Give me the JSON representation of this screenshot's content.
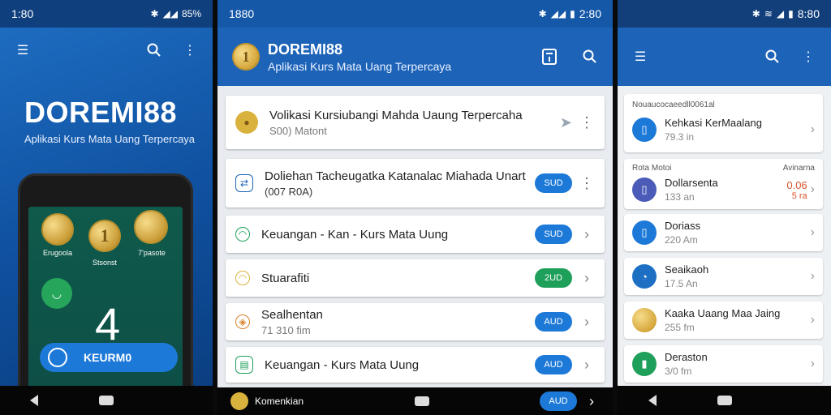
{
  "panel1": {
    "status_time": "1:80",
    "status_battery": "85%",
    "title": "DOREMI88",
    "subtitle": "Aplikasi Kurs Mata Uang Terpercaya",
    "phone": {
      "coins": [
        {
          "glyph": "",
          "label": "Erugoola"
        },
        {
          "glyph": "1",
          "label": "Stsonst"
        },
        {
          "glyph": "",
          "label": "7'pasote"
        }
      ],
      "big_number": "4",
      "button_label": "KEURM0"
    }
  },
  "panel2": {
    "status_time": "1880",
    "status_clock": "2:80",
    "title": "DOREMI88",
    "subtitle": "Aplikasi Kurs Mata Uang Terpercaya",
    "logo_glyph": "1",
    "cards": [
      {
        "main": "Volikasi Kursiubangi Mahda Uaung Terpercaha",
        "sub": "S00) Matont",
        "lead_color": "#d9b23d"
      },
      {
        "main": "Doliehan Tacheugatka Katanalac Miahada Unart",
        "sub": "(007 R0A)",
        "badge": "SUD",
        "badge_color": "#1d79d8"
      },
      {
        "main": "Keuangan - Kan - Kurs Mata Uung",
        "badge": "SUD",
        "badge_color": "#1d79d8"
      },
      {
        "main": "Stuarafiti",
        "badge": "2UD",
        "badge_color": "#1fa05a"
      },
      {
        "main": "Sealhentan",
        "sub": "71 310 fim",
        "badge": "AUD",
        "badge_color": "#1d79d8"
      },
      {
        "main": "Keuangan - Kurs Mata Uung",
        "badge": "AUD",
        "badge_color": "#1d79d8"
      },
      {
        "main": "Komenkian",
        "badge": "AUD",
        "badge_color": "#1d79d8"
      }
    ]
  },
  "panel3": {
    "status_clock": "8:80",
    "section1_label": "Nouaucocaeedll0061al",
    "section2_label": "Rota Motoi",
    "section2_right": "Avinarna",
    "rows": [
      {
        "a": "Kehkasi KerMaalang",
        "b": "79.3 in",
        "color": "#1d79d8",
        "glyph": "▯"
      },
      {
        "a": "Dollarsenta",
        "b": "133 an",
        "color": "#4b5bb8",
        "glyph": "▯",
        "value": "0.06",
        "value2": "5 ra"
      },
      {
        "a": "Doriass",
        "b": "220 Am",
        "color": "#1d79d8",
        "glyph": "▯"
      },
      {
        "a": "Seaikaoh",
        "b": "17.5 An",
        "color": "#1d6fc4",
        "glyph": "◔"
      },
      {
        "a": "Kaaka Uaang Maa Jaing",
        "b": "255 fm",
        "color": "#d9b23d",
        "glyph": "◉"
      },
      {
        "a": "Deraston",
        "b": "3/0 fm",
        "color": "#1fa05a",
        "glyph": "▮"
      }
    ]
  },
  "colors": {
    "primary": "#1d63b8",
    "status": "#0f3f7c",
    "green": "#1fa05a",
    "gold": "#d9b23d",
    "accent_red": "#d9532b"
  },
  "icons": [
    "menu-icon",
    "search-icon",
    "more-vert-icon",
    "bluetooth-icon",
    "signal-icon",
    "battery-icon",
    "wifi-icon",
    "calculator-icon",
    "send-icon",
    "chevron-right-icon",
    "back-icon",
    "home-icon"
  ]
}
